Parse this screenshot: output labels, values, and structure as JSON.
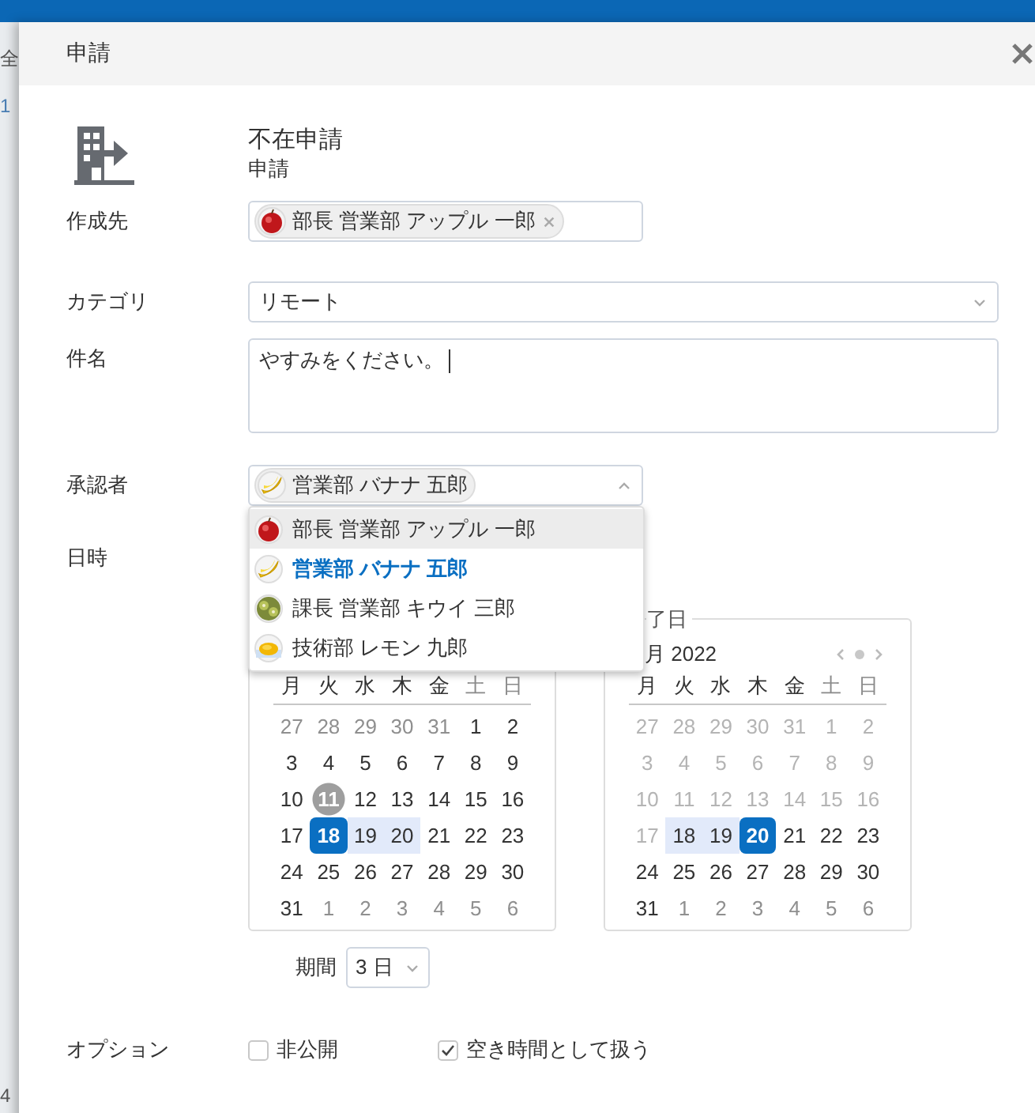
{
  "background": {
    "strip_texts": [
      "全",
      "1",
      "4"
    ]
  },
  "dialog": {
    "title": "申請"
  },
  "heading": {
    "title": "不在申請",
    "subtitle": "申請"
  },
  "recipient": {
    "label": "作成先",
    "tokens": [
      {
        "name": "部長 営業部 アップル 一郎",
        "kind": "apple",
        "removable": true
      }
    ]
  },
  "category": {
    "label": "カテゴリ",
    "value": "リモート"
  },
  "subject": {
    "label": "件名",
    "value": "やすみをください。",
    "focused": true
  },
  "approver": {
    "label": "承認者",
    "expanded": true,
    "tokens": [
      {
        "name": "営業部 バナナ 五郎",
        "kind": "banana",
        "removable": false
      }
    ],
    "options": [
      {
        "name": "部長 営業部 アップル 一郎",
        "kind": "apple",
        "selected": false,
        "highlighted": true
      },
      {
        "name": "営業部 バナナ 五郎",
        "kind": "banana",
        "selected": true,
        "highlighted": false
      },
      {
        "name": "課長 営業部 キウイ 三郎",
        "kind": "kiwi",
        "selected": false,
        "highlighted": false
      },
      {
        "name": "技術部 レモン 九郎",
        "kind": "lemon",
        "selected": false,
        "highlighted": false
      }
    ]
  },
  "datetime": {
    "label": "日時",
    "calendars": [
      {
        "weekdays": [
          {
            "label": "月",
            "weekend": false
          },
          {
            "label": "火",
            "weekend": false
          },
          {
            "label": "水",
            "weekend": false
          },
          {
            "label": "木",
            "weekend": false
          },
          {
            "label": "金",
            "weekend": false
          },
          {
            "label": "土",
            "weekend": true
          },
          {
            "label": "日",
            "weekend": true
          }
        ],
        "days": [
          {
            "d": "27",
            "kind": "outside",
            "selected": false
          },
          {
            "d": "28",
            "kind": "outside",
            "selected": false
          },
          {
            "d": "29",
            "kind": "outside",
            "selected": false
          },
          {
            "d": "30",
            "kind": "outside",
            "selected": false
          },
          {
            "d": "31",
            "kind": "outside",
            "selected": false
          },
          {
            "d": "1",
            "kind": "normal",
            "selected": false
          },
          {
            "d": "2",
            "kind": "normal",
            "selected": false
          },
          {
            "d": "3",
            "kind": "normal",
            "selected": false
          },
          {
            "d": "4",
            "kind": "normal",
            "selected": false
          },
          {
            "d": "5",
            "kind": "normal",
            "selected": false
          },
          {
            "d": "6",
            "kind": "normal",
            "selected": false
          },
          {
            "d": "7",
            "kind": "normal",
            "selected": false
          },
          {
            "d": "8",
            "kind": "normal",
            "selected": false
          },
          {
            "d": "9",
            "kind": "normal",
            "selected": false
          },
          {
            "d": "10",
            "kind": "normal",
            "selected": false
          },
          {
            "d": "11",
            "kind": "today",
            "selected": false
          },
          {
            "d": "12",
            "kind": "normal",
            "selected": false
          },
          {
            "d": "13",
            "kind": "normal",
            "selected": false
          },
          {
            "d": "14",
            "kind": "normal",
            "selected": false
          },
          {
            "d": "15",
            "kind": "normal",
            "selected": false
          },
          {
            "d": "16",
            "kind": "normal",
            "selected": false
          },
          {
            "d": "17",
            "kind": "normal",
            "selected": false
          },
          {
            "d": "18",
            "kind": "normal",
            "selected": true
          },
          {
            "d": "19",
            "kind": "range",
            "selected": false
          },
          {
            "d": "20",
            "kind": "range",
            "selected": false
          },
          {
            "d": "21",
            "kind": "normal",
            "selected": false
          },
          {
            "d": "22",
            "kind": "normal",
            "selected": false
          },
          {
            "d": "23",
            "kind": "normal",
            "selected": false
          },
          {
            "d": "24",
            "kind": "normal",
            "selected": false
          },
          {
            "d": "25",
            "kind": "normal",
            "selected": false
          },
          {
            "d": "26",
            "kind": "normal",
            "selected": false
          },
          {
            "d": "27",
            "kind": "normal",
            "selected": false
          },
          {
            "d": "28",
            "kind": "normal",
            "selected": false
          },
          {
            "d": "29",
            "kind": "normal",
            "selected": false
          },
          {
            "d": "30",
            "kind": "normal",
            "selected": false
          },
          {
            "d": "31",
            "kind": "normal",
            "selected": false
          },
          {
            "d": "1",
            "kind": "outside",
            "selected": false
          },
          {
            "d": "2",
            "kind": "outside",
            "selected": false
          },
          {
            "d": "3",
            "kind": "outside",
            "selected": false
          },
          {
            "d": "4",
            "kind": "outside",
            "selected": false
          },
          {
            "d": "5",
            "kind": "outside",
            "selected": false
          },
          {
            "d": "6",
            "kind": "outside",
            "selected": false
          }
        ]
      },
      {
        "legend": "了日",
        "month": "月 2022",
        "nav": true,
        "weekdays": [
          {
            "label": "月",
            "weekend": false
          },
          {
            "label": "火",
            "weekend": false
          },
          {
            "label": "水",
            "weekend": false
          },
          {
            "label": "木",
            "weekend": false
          },
          {
            "label": "金",
            "weekend": false
          },
          {
            "label": "土",
            "weekend": true
          },
          {
            "label": "日",
            "weekend": true
          }
        ],
        "days": [
          {
            "d": "27",
            "kind": "disabled",
            "selected": false
          },
          {
            "d": "28",
            "kind": "disabled",
            "selected": false
          },
          {
            "d": "29",
            "kind": "disabled",
            "selected": false
          },
          {
            "d": "30",
            "kind": "disabled",
            "selected": false
          },
          {
            "d": "31",
            "kind": "disabled",
            "selected": false
          },
          {
            "d": "1",
            "kind": "disabled",
            "selected": false
          },
          {
            "d": "2",
            "kind": "disabled",
            "selected": false
          },
          {
            "d": "3",
            "kind": "disabled",
            "selected": false
          },
          {
            "d": "4",
            "kind": "disabled",
            "selected": false
          },
          {
            "d": "5",
            "kind": "disabled",
            "selected": false
          },
          {
            "d": "6",
            "kind": "disabled",
            "selected": false
          },
          {
            "d": "7",
            "kind": "disabled",
            "selected": false
          },
          {
            "d": "8",
            "kind": "disabled",
            "selected": false
          },
          {
            "d": "9",
            "kind": "disabled",
            "selected": false
          },
          {
            "d": "10",
            "kind": "disabled",
            "selected": false
          },
          {
            "d": "11",
            "kind": "disabled",
            "selected": false
          },
          {
            "d": "12",
            "kind": "disabled",
            "selected": false
          },
          {
            "d": "13",
            "kind": "disabled",
            "selected": false
          },
          {
            "d": "14",
            "kind": "disabled",
            "selected": false
          },
          {
            "d": "15",
            "kind": "disabled",
            "selected": false
          },
          {
            "d": "16",
            "kind": "disabled",
            "selected": false
          },
          {
            "d": "17",
            "kind": "disabled",
            "selected": false
          },
          {
            "d": "18",
            "kind": "range",
            "selected": false
          },
          {
            "d": "19",
            "kind": "range",
            "selected": false
          },
          {
            "d": "20",
            "kind": "normal",
            "selected": true
          },
          {
            "d": "21",
            "kind": "normal",
            "selected": false
          },
          {
            "d": "22",
            "kind": "normal",
            "selected": false
          },
          {
            "d": "23",
            "kind": "normal",
            "selected": false
          },
          {
            "d": "24",
            "kind": "normal",
            "selected": false
          },
          {
            "d": "25",
            "kind": "normal",
            "selected": false
          },
          {
            "d": "26",
            "kind": "normal",
            "selected": false
          },
          {
            "d": "27",
            "kind": "normal",
            "selected": false
          },
          {
            "d": "28",
            "kind": "normal",
            "selected": false
          },
          {
            "d": "29",
            "kind": "normal",
            "selected": false
          },
          {
            "d": "30",
            "kind": "normal",
            "selected": false
          },
          {
            "d": "31",
            "kind": "normal",
            "selected": false
          },
          {
            "d": "1",
            "kind": "outside",
            "selected": false
          },
          {
            "d": "2",
            "kind": "outside",
            "selected": false
          },
          {
            "d": "3",
            "kind": "outside",
            "selected": false
          },
          {
            "d": "4",
            "kind": "outside",
            "selected": false
          },
          {
            "d": "5",
            "kind": "outside",
            "selected": false
          },
          {
            "d": "6",
            "kind": "outside",
            "selected": false
          }
        ]
      }
    ]
  },
  "period": {
    "label": "期間",
    "value": "3 日"
  },
  "options": {
    "label": "オプション",
    "items": [
      {
        "label": "非公開",
        "checked": false
      },
      {
        "label": "空き時間として扱う",
        "checked": true
      }
    ]
  }
}
